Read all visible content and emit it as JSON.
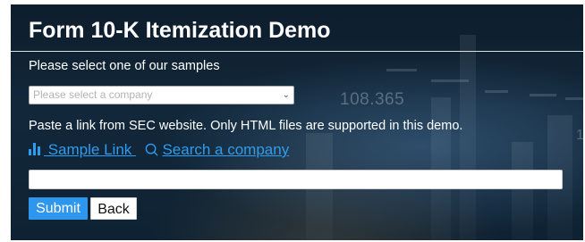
{
  "header": {
    "title": "Form 10-K Itemization Demo"
  },
  "samples": {
    "prompt": "Please select one of our samples",
    "select_placeholder": "Please select a company"
  },
  "paste": {
    "instruction": "Paste a link from SEC website. Only HTML files are supported in this demo."
  },
  "links": {
    "sample_link_label": " Sample Link ",
    "search_label": "Search a company",
    "sample_icon": "bar-chart-icon",
    "search_icon": "search-icon"
  },
  "url_input": {
    "value": "",
    "placeholder": ""
  },
  "buttons": {
    "submit_label": "Submit",
    "back_label": "Back"
  },
  "background": {
    "ticker_value": "108.365",
    "edge_value": "1"
  },
  "colors": {
    "accent": "#2e9cf0",
    "submit_bg": "#2f96ee",
    "text": "#ffffff"
  }
}
